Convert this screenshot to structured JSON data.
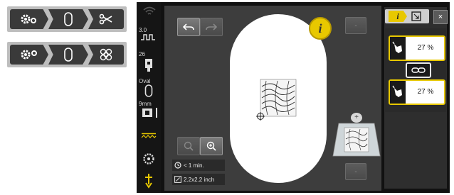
{
  "strip1": {
    "items": [
      {
        "name": "settings",
        "icon": "gears-icon"
      },
      {
        "name": "hoop",
        "icon": "oval-hoop-icon"
      },
      {
        "name": "cut",
        "icon": "scissors-icon"
      }
    ]
  },
  "strip2": {
    "items": [
      {
        "name": "settings",
        "icon": "gears-icon"
      },
      {
        "name": "hoop",
        "icon": "oval-hoop-icon"
      },
      {
        "name": "pattern",
        "icon": "knot-pattern-icon"
      }
    ]
  },
  "sidebar": {
    "speed_value": "3.0",
    "needle_value": "26",
    "hoop_label": "Oval",
    "size_label": "9mm"
  },
  "info": {
    "time": "< 1 min.",
    "size": "2.2x2.2 inch"
  },
  "right_panel": {
    "zoom_top": "27 %",
    "zoom_bottom": "27 %"
  },
  "colors": {
    "accent_yellow": "#e8c800",
    "screen_bg": "#3d3d3d",
    "hoop_white": "#ffffff"
  }
}
